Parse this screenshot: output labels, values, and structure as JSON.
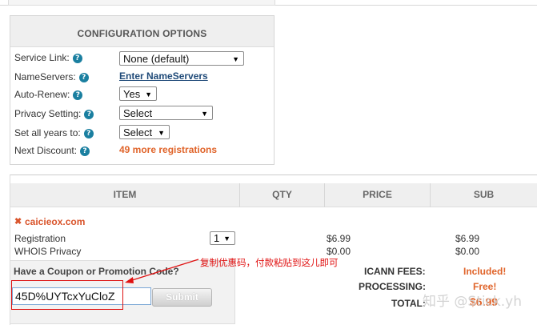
{
  "config": {
    "title": "CONFIGURATION OPTIONS",
    "service_link": {
      "label": "Service Link:",
      "value": "None (default)"
    },
    "nameservers": {
      "label": "NameServers:",
      "link": "Enter NameServers"
    },
    "auto_renew": {
      "label": "Auto-Renew:",
      "value": "Yes"
    },
    "privacy": {
      "label": "Privacy Setting:",
      "value": "Select"
    },
    "all_years": {
      "label": "Set all years to:",
      "value": "Select"
    },
    "next_discount": {
      "label": "Next Discount:",
      "value": "49 more registrations"
    },
    "help_glyph": "?"
  },
  "cart": {
    "columns": [
      "ITEM",
      "QTY",
      "PRICE",
      "SUB"
    ],
    "domain": "caicieox.com",
    "remove_glyph": "✖",
    "rows": [
      {
        "item": "Registration",
        "qty": "1",
        "price": "$6.99",
        "sub": "$6.99"
      },
      {
        "item": "WHOIS Privacy",
        "price": "$0.00",
        "sub": "$0.00"
      }
    ]
  },
  "coupon": {
    "title": "Have a Coupon or Promotion Code?",
    "code": "45D%UYTcxYuCloZ",
    "submit_label": "Submit"
  },
  "annotation": "复制优惠码，付款粘贴到这儿即可",
  "fees": {
    "icann_label": "ICANN FEES:",
    "icann_value": "Included!",
    "processing_label": "PROCESSING:",
    "processing_value": "Free!",
    "total_label": "TOTAL:",
    "total_value": "$6.99"
  },
  "watermark": "知乎 @Stick.yh",
  "colors": {
    "accent_orange": "#e0642a",
    "link_blue": "#1f4a78",
    "help_blue": "#1a7fa0",
    "annotation_red": "#e01010"
  }
}
